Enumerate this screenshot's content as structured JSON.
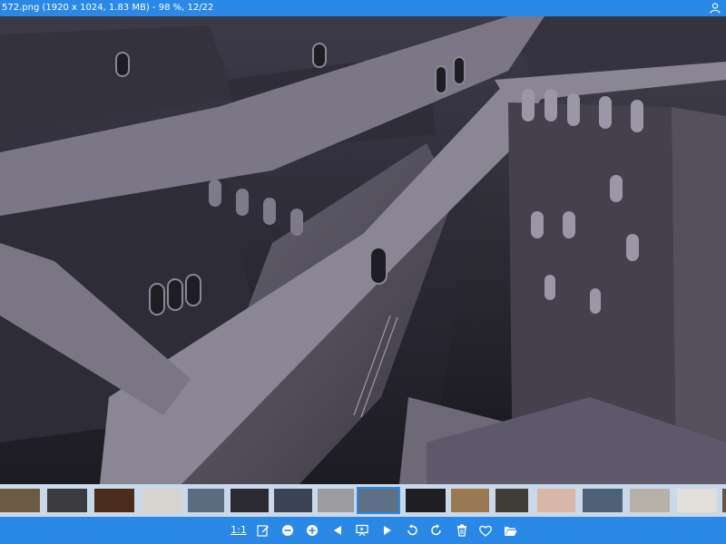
{
  "window": {
    "title": "572.png (1920 x 1024, 1.83 MB) - 98 %, 12/22"
  },
  "viewer": {
    "image_name": "maze-walls-render"
  },
  "thumbnails": [
    {
      "color": "#6b5a44"
    },
    {
      "color": "#3b3b3f"
    },
    {
      "color": "#4a2b1c"
    },
    {
      "color": "#d7d4cf"
    },
    {
      "color": "#5b6c80"
    },
    {
      "color": "#2a2a30"
    },
    {
      "color": "#3c4354"
    },
    {
      "color": "#9c9ca0"
    },
    {
      "color": "#5f6f86"
    },
    {
      "color": "#1f1f22"
    },
    {
      "color": "#9a7a52"
    },
    {
      "color": "#3e3e36"
    },
    {
      "color": "#d9b7a8"
    },
    {
      "color": "#4d6178"
    },
    {
      "color": "#b7b1a9"
    },
    {
      "color": "#e3e0dc"
    },
    {
      "color": "#6c5340"
    }
  ],
  "toolbar": {
    "actual_size_label": "1:1",
    "icons": [
      "edit-icon",
      "zoom-out-icon",
      "zoom-in-icon",
      "previous-icon",
      "slideshow-icon",
      "next-icon",
      "rotate-left-icon",
      "rotate-right-icon",
      "delete-icon",
      "favorite-icon",
      "open-folder-icon"
    ]
  },
  "colors": {
    "accent": "#2a89e6",
    "strip_bg": "#c9d9ea"
  }
}
